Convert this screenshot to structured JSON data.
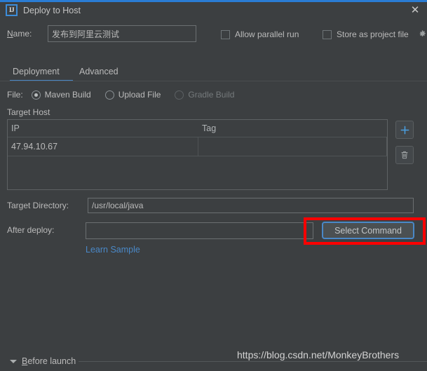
{
  "window": {
    "title": "Deploy to Host",
    "app_icon": "intellij-idea-icon",
    "app_icon_text": "IJ",
    "close_icon": "✕",
    "accent_color": "#2a7cd4",
    "background_color": "#3c3f41"
  },
  "name_row": {
    "label_prefix": "N",
    "label_rest": "ame:",
    "label_full": "Name:",
    "value": "发布到阿里云测试",
    "placeholder": "",
    "allow_parallel_run": {
      "label_prefix": "",
      "label": "Allow parallel run",
      "checked": false
    },
    "store_as_project_file": {
      "label": "Store as project file",
      "checked": false
    },
    "gear_icon": "gear-icon"
  },
  "tabs": {
    "items": [
      {
        "label": "Deployment",
        "selected": true
      },
      {
        "label": "Advanced",
        "selected": false
      }
    ],
    "active_underline_color": "#4a88c7"
  },
  "file_row": {
    "label": "File:",
    "options": [
      {
        "label": "Maven Build",
        "selected": true,
        "disabled": false
      },
      {
        "label": "Upload File",
        "selected": false,
        "disabled": false
      },
      {
        "label": "Gradle Build",
        "selected": false,
        "disabled": true
      }
    ]
  },
  "target_host": {
    "section_label": "Target Host",
    "columns": [
      "IP",
      "Tag"
    ],
    "rows": [
      {
        "ip": "47.94.10.67",
        "tag": ""
      }
    ],
    "add_button": {
      "name": "add-host-button",
      "icon": "plus-icon",
      "glyph": "+",
      "color": "#4a9fe0"
    },
    "delete_button": {
      "name": "delete-host-button",
      "icon": "trash-icon"
    }
  },
  "target_directory": {
    "label": "Target Directory:",
    "value": "/usr/local/java",
    "placeholder": ""
  },
  "after_deploy": {
    "label": "After deploy:",
    "value": "",
    "placeholder": "",
    "button_label": "Select Command",
    "button_focused": true,
    "button_border_color": "#4a88c7",
    "highlight_color": "#fe0000",
    "link_label": "Learn Sample",
    "link_color": "#4a88c7"
  },
  "footer": {
    "before_launch_label": "Before launch",
    "before_launch_prefix": "B",
    "before_launch_rest": "efore launch",
    "expanded": true,
    "watermark": "https://blog.csdn.net/MonkeyBrothers"
  }
}
